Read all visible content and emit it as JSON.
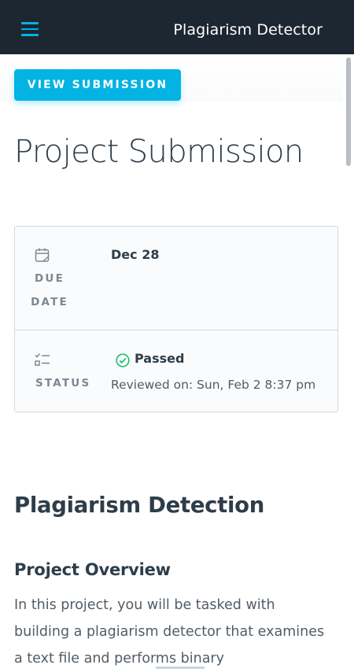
{
  "header": {
    "title": "Plagiarism Detector",
    "menu_icon": "hamburger-menu-icon",
    "background": "#1d2731",
    "accent": "#02b3e4"
  },
  "actions": {
    "view_submission_label": "VIEW SUBMISSION"
  },
  "page": {
    "title": "Project Submission"
  },
  "info_card": {
    "due": {
      "icon": "calendar-icon",
      "label_line1": "DUE",
      "label_line2": "DATE",
      "value": "Dec 28"
    },
    "status": {
      "icon": "checklist-icon",
      "label": "STATUS",
      "status_icon": "check-circle-icon",
      "status_color": "#15c26b",
      "value": "Passed",
      "reviewed": "Reviewed on: Sun, Feb 2 8:37 pm"
    }
  },
  "content": {
    "section_title": "Plagiarism Detection",
    "overview_title": "Project Overview",
    "overview_text": "In this project, you will be tasked with building a plagiarism detector that examines a text file and performs binary"
  }
}
